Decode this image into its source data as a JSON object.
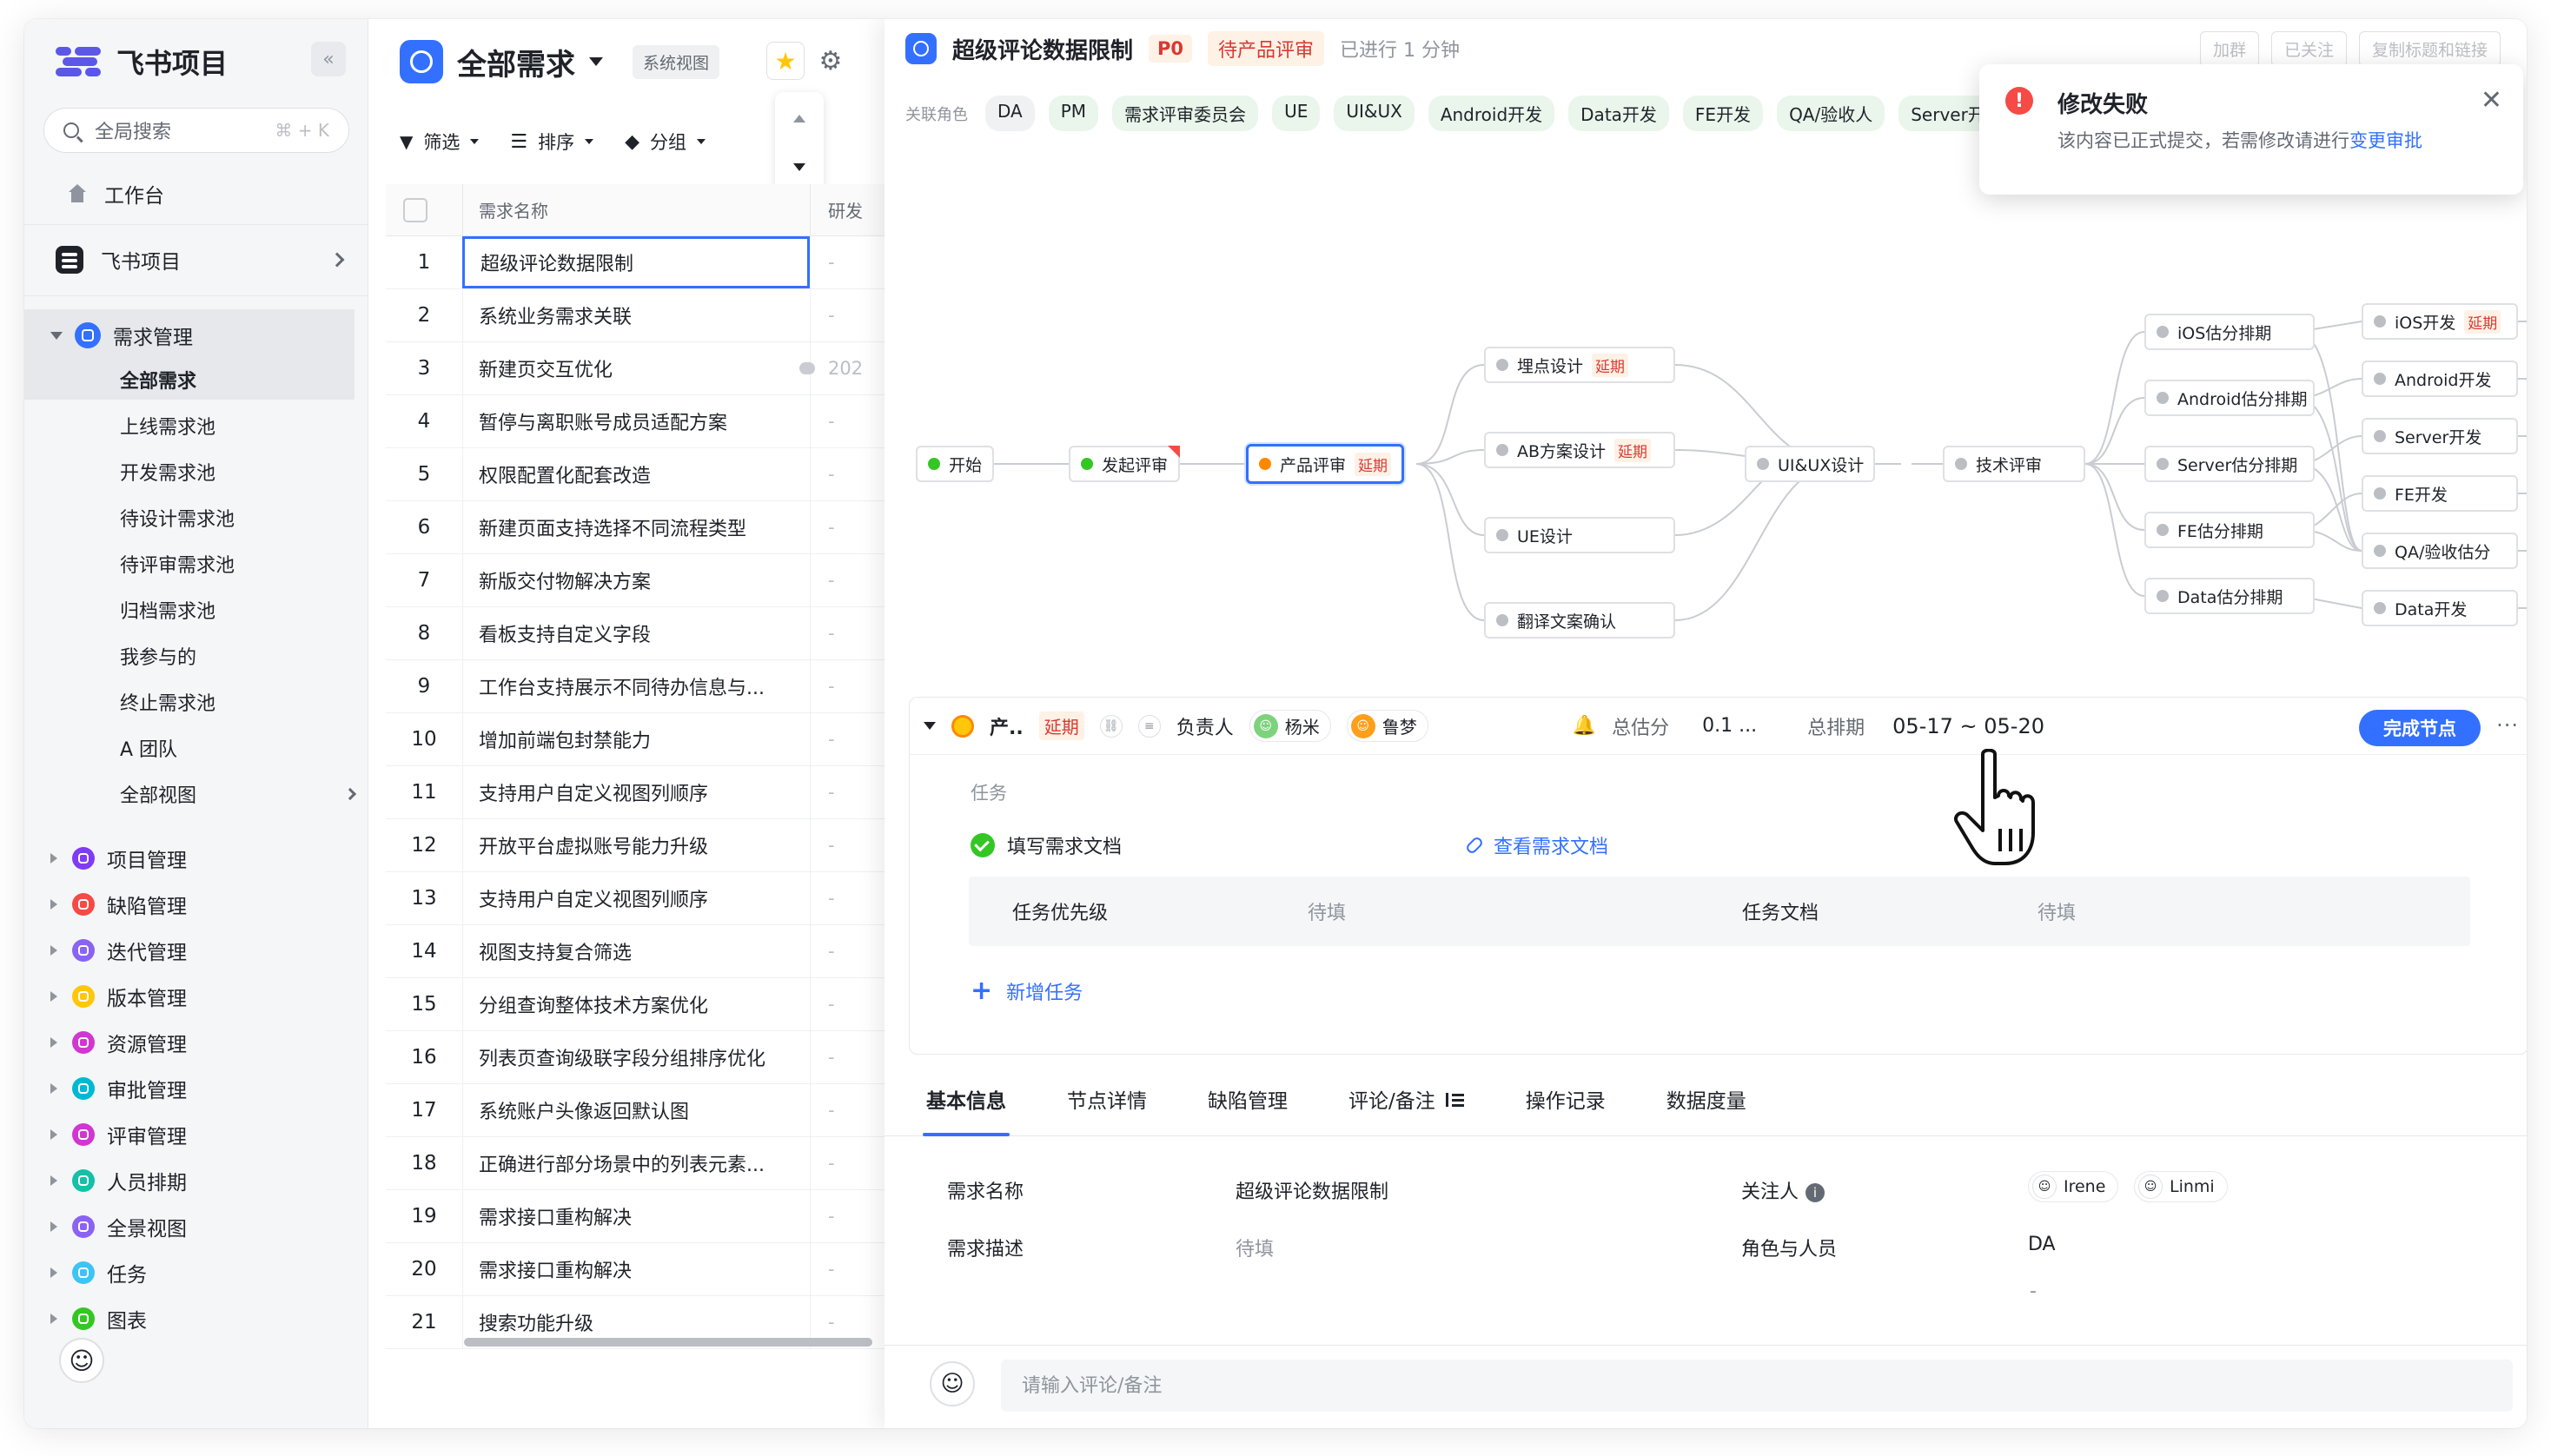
{
  "app": {
    "logo_text": "飞书项目",
    "search_placeholder": "全局搜索",
    "search_shortcut": "⌘ + K",
    "home": "工作台",
    "project": "飞书项目"
  },
  "sidebar": {
    "active_module": "需求管理",
    "sub_items": [
      "全部需求",
      "上线需求池",
      "开发需求池",
      "待设计需求池",
      "待评审需求池",
      "归档需求池",
      "我参与的",
      "终止需求池",
      "A 团队",
      "全部视图"
    ],
    "modules": [
      {
        "label": "项目管理",
        "color": "#7f3bf5"
      },
      {
        "label": "缺陷管理",
        "color": "#f54a45"
      },
      {
        "label": "迭代管理",
        "color": "#8a63f5"
      },
      {
        "label": "版本管理",
        "color": "#ffc60a"
      },
      {
        "label": "资源管理",
        "color": "#d136d1"
      },
      {
        "label": "审批管理",
        "color": "#00b8d4"
      },
      {
        "label": "评审管理",
        "color": "#d136d1"
      },
      {
        "label": "人员排期",
        "color": "#14c0a8"
      },
      {
        "label": "全景视图",
        "color": "#8a63f5"
      },
      {
        "label": "任务",
        "color": "#3ec3f7"
      },
      {
        "label": "图表",
        "color": "#34c724"
      }
    ]
  },
  "list": {
    "title": "全部需求",
    "view_badge": "系统视图",
    "filter": "筛选",
    "sort": "排序",
    "group": "分组",
    "col_name": "需求名称",
    "col_dev": "研发",
    "rows": [
      {
        "idx": "1",
        "name": "超级评论数据限制",
        "dev": "-"
      },
      {
        "idx": "2",
        "name": "系统业务需求关联",
        "dev": "-"
      },
      {
        "idx": "3",
        "name": "新建页交互优化",
        "dev": "202"
      },
      {
        "idx": "4",
        "name": "暂停与离职账号成员适配方案",
        "dev": "-"
      },
      {
        "idx": "5",
        "name": "权限配置化配套改造",
        "dev": "-"
      },
      {
        "idx": "6",
        "name": "新建页面支持选择不同流程类型",
        "dev": "-"
      },
      {
        "idx": "7",
        "name": "新版交付物解决方案",
        "dev": "-"
      },
      {
        "idx": "8",
        "name": "看板支持自定义字段",
        "dev": "-"
      },
      {
        "idx": "9",
        "name": "工作台支持展示不同待办信息与...",
        "dev": "-"
      },
      {
        "idx": "10",
        "name": "增加前端包封禁能力",
        "dev": "-"
      },
      {
        "idx": "11",
        "name": "支持用户自定义视图列顺序",
        "dev": "-"
      },
      {
        "idx": "12",
        "name": "开放平台虚拟账号能力升级",
        "dev": "-"
      },
      {
        "idx": "13",
        "name": "支持用户自定义视图列顺序",
        "dev": "-"
      },
      {
        "idx": "14",
        "name": "视图支持复合筛选",
        "dev": "-"
      },
      {
        "idx": "15",
        "name": "分组查询整体技术方案优化",
        "dev": "-"
      },
      {
        "idx": "16",
        "name": "列表页查询级联字段分组排序优化",
        "dev": "-"
      },
      {
        "idx": "17",
        "name": "系统账户头像返回默认图",
        "dev": "-"
      },
      {
        "idx": "18",
        "name": "正确进行部分场景中的列表元素...",
        "dev": "-"
      },
      {
        "idx": "19",
        "name": "需求接口重构解决",
        "dev": "-"
      },
      {
        "idx": "20",
        "name": "需求接口重构解决",
        "dev": "-"
      },
      {
        "idx": "21",
        "name": "搜索功能升级",
        "dev": "-"
      }
    ]
  },
  "detail": {
    "title": "超级评论数据限制",
    "priority": "P0",
    "stage": "待产品评审",
    "elapsed": "已进行 1 分钟",
    "roles_label": "关联角色",
    "roles": [
      "DA",
      "PM",
      "需求评审委员会",
      "UE",
      "UI&UX",
      "Android开发",
      "Data开发",
      "FE开发",
      "QA/验收人",
      "Server开"
    ],
    "faded_tabs": [
      "加群",
      "已关注",
      "复制标题和链接"
    ],
    "flow_nodes": {
      "start": "开始",
      "initiate": "发起评审",
      "product_review": "产品评审",
      "tracking": "埋点设计",
      "ab": "AB方案设计",
      "ue": "UE设计",
      "translate": "翻译文案确认",
      "uiux": "UI&UX设计",
      "tech": "技术评审",
      "ios_est": "iOS估分排期",
      "android_est": "Android估分排期",
      "server_est": "Server估分排期",
      "fe_est": "FE估分排期",
      "data_est": "Data估分排期",
      "ios_dev": "iOS开发",
      "android_dev": "Android开发",
      "server_dev": "Server开发",
      "fe_dev": "FE开发",
      "qa": "QA/验收估分",
      "data_dev": "Data开发",
      "delay": "延期"
    },
    "node_info": {
      "name": "产..",
      "delay": "延期",
      "owner_label": "负责人",
      "owners": [
        "杨米",
        "鲁梦"
      ],
      "estimate_label": "总估分",
      "estimate_value": "0.1 ...",
      "schedule_label": "总排期",
      "schedule_value": "05-17 ~ 05-20",
      "done_button": "完成节点",
      "task_label": "任务",
      "task_name": "填写需求文档",
      "doc_link": "查看需求文档",
      "priority_label": "任务优先级",
      "priority_value": "待填",
      "doc_label": "任务文档",
      "doc_value": "待填",
      "add_task": "新增任务"
    },
    "tabs": [
      "基本信息",
      "节点详情",
      "缺陷管理",
      "评论/备注",
      "操作记录",
      "数据度量"
    ],
    "basic": {
      "name_label": "需求名称",
      "name_value": "超级评论数据限制",
      "desc_label": "需求描述",
      "desc_value": "待填",
      "watcher_label": "关注人",
      "watchers": [
        "Irene",
        "Linmi"
      ],
      "role_label": "角色与人员",
      "role_value": "DA",
      "role_value2": "-"
    },
    "comment_placeholder": "请输入评论/备注"
  },
  "toast": {
    "title": "修改失败",
    "message": "该内容已正式提交，若需修改请进行",
    "link": "变更审批"
  },
  "colors": {
    "accent": "#3370ff",
    "danger": "#f54a45",
    "success": "#34c724",
    "warning": "#ff8800"
  }
}
